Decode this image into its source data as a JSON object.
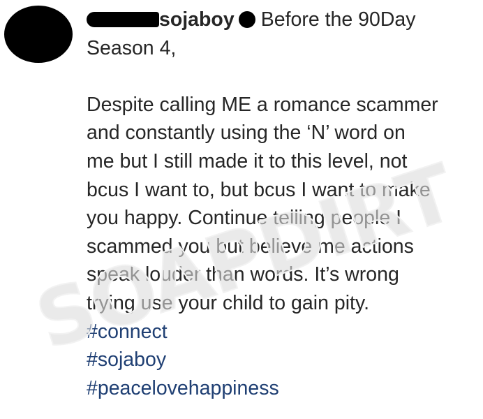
{
  "post": {
    "username": "sojaboy",
    "header_text": "Before the 90Day",
    "lines": [
      "Season 4,",
      "",
      "Despite calling ME a romance scammer",
      "and constantly using the ‘N’ word on",
      "me but I still made it to this level, not",
      "bcus I want to, but bcus I want to make",
      "you happy. Continue telling people I",
      "scammed you but believe me actions",
      "speak louder than words. It’s wrong",
      "trying use your child to gain pity."
    ],
    "hashtags": [
      "#connect",
      "#sojaboy",
      "#peacelovehappiness"
    ],
    "watermark": "SOAPDIRT"
  },
  "colors": {
    "text": "#262626",
    "hashtag": "#1f3f73",
    "redaction": "#000000"
  }
}
